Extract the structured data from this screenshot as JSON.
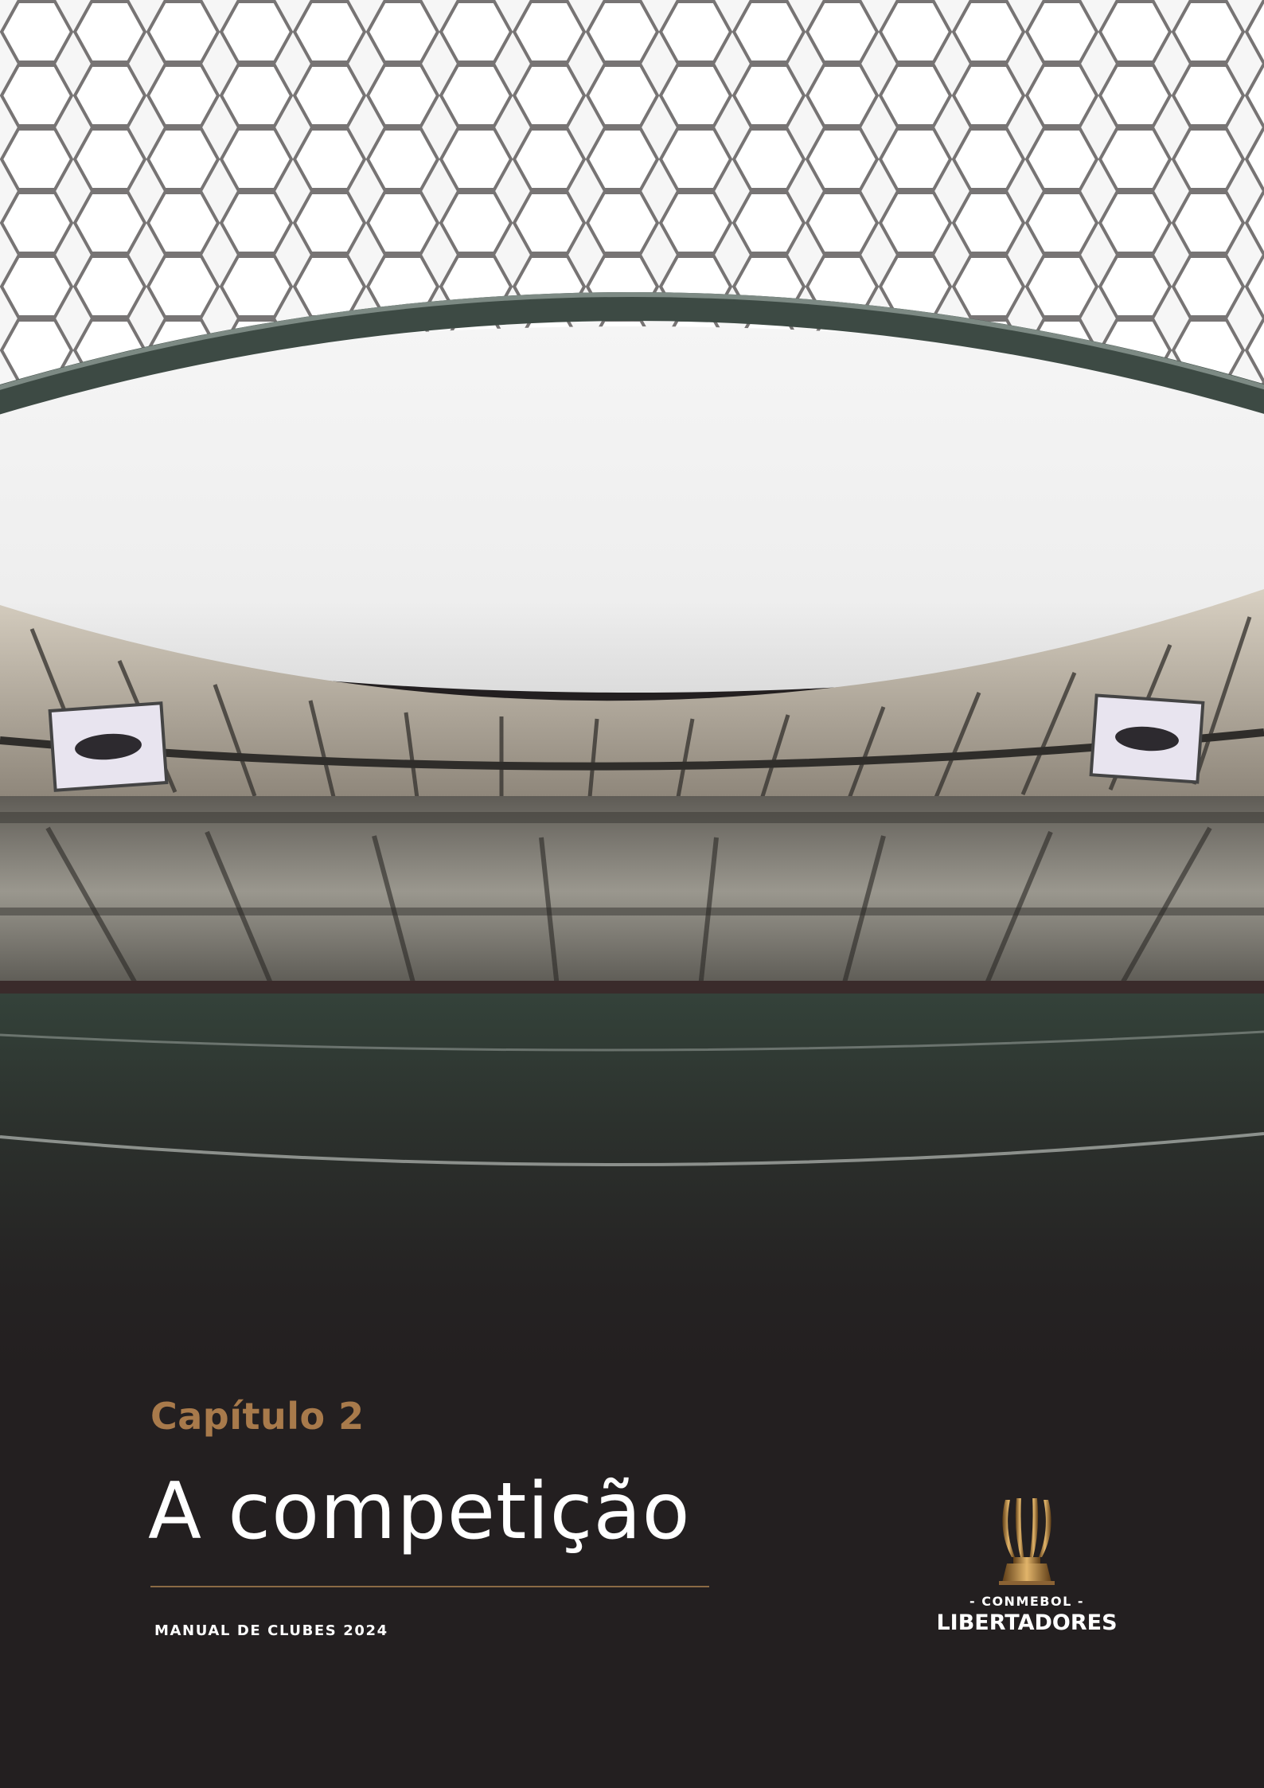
{
  "cover": {
    "chapter": "Capítulo 2",
    "title": "A competição",
    "subtitle": "MANUAL DE CLUBES 2024"
  },
  "logo": {
    "icon": "trophy-icon",
    "org": "- CONMEBOL -",
    "name": "LIBERTADORES"
  },
  "colors": {
    "background": "#231f20",
    "accent_gold": "#a87a4b",
    "text": "#ffffff"
  }
}
